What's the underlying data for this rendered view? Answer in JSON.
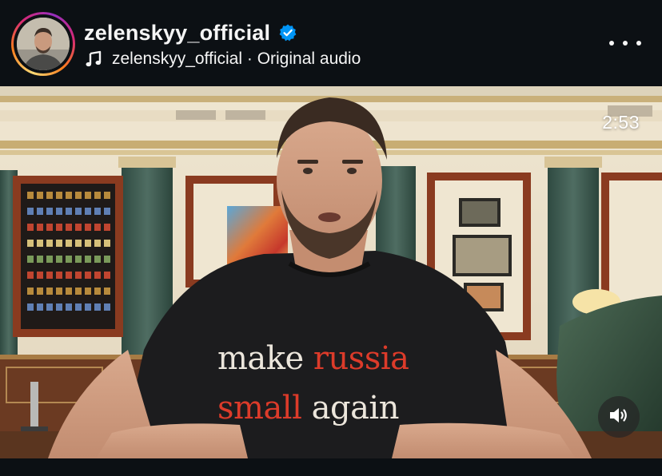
{
  "header": {
    "username": "zelenskyy_official",
    "audio_label": "zelenskyy_official · Original audio"
  },
  "video": {
    "timer": "2:53",
    "shirt_line1_white": "make ",
    "shirt_line1_red": "russia",
    "shirt_line2_red": "small ",
    "shirt_line2_white": "again"
  },
  "icons": {
    "verified": "verified-badge-icon",
    "audio": "music-note-icon",
    "more": "more-options-icon",
    "sound": "speaker-icon"
  },
  "colors": {
    "background": "#0c1014",
    "verified": "#0095f6",
    "shirt_red": "#dc3b2a",
    "shirt_white": "#ece6dc"
  }
}
